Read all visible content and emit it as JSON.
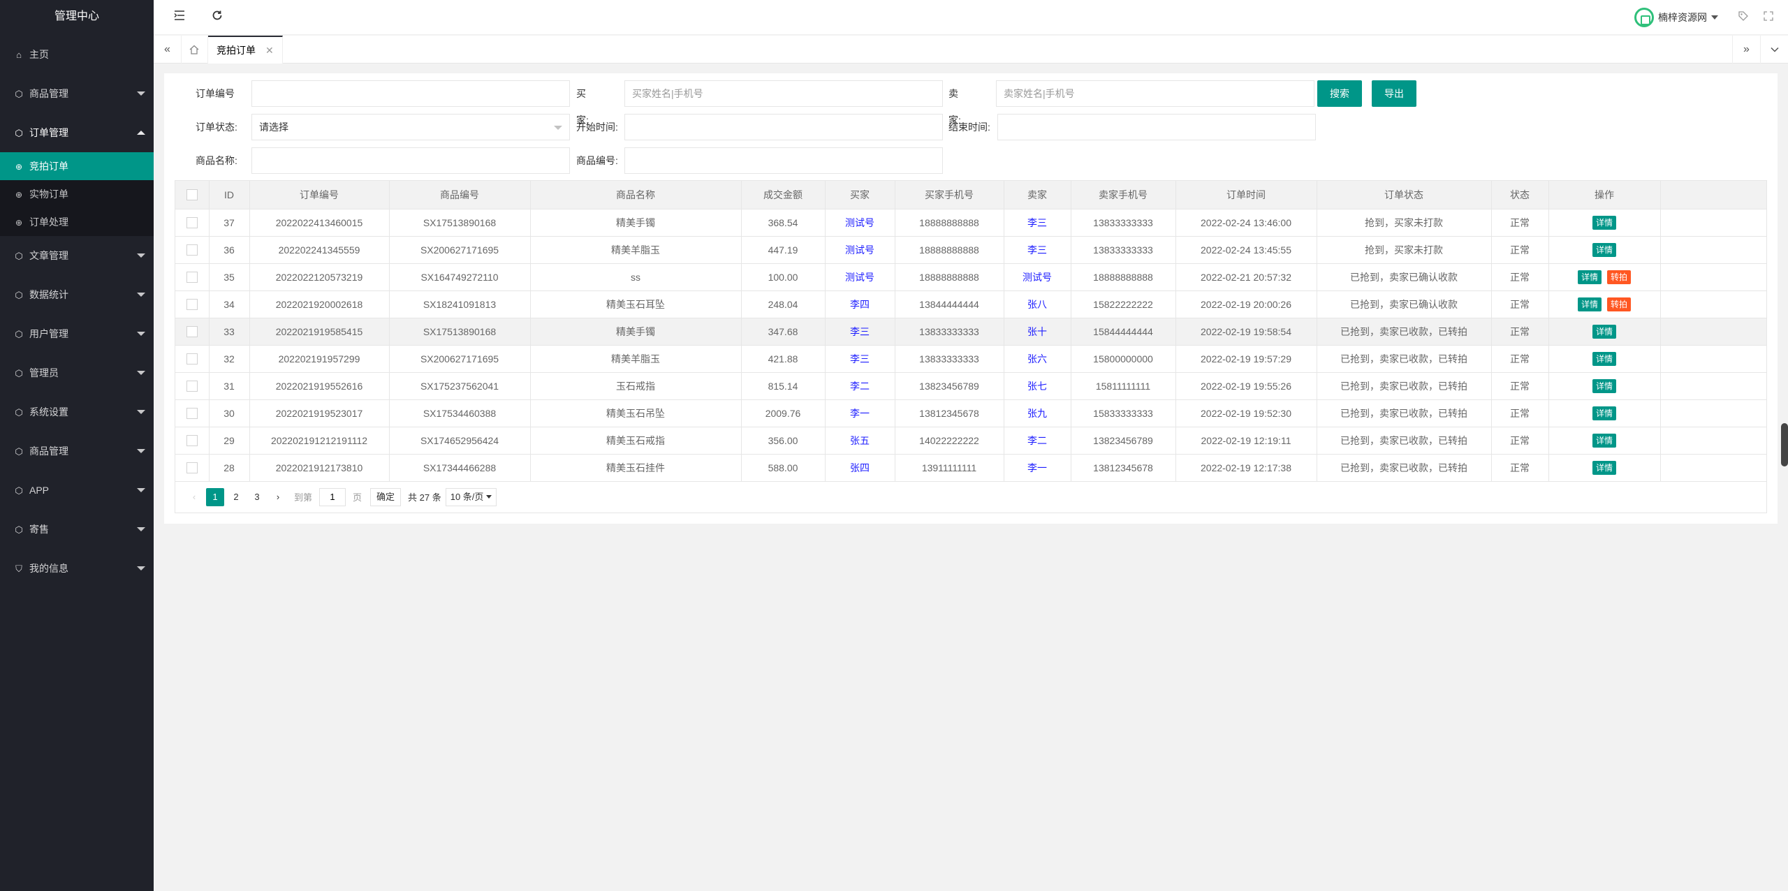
{
  "sidebar": {
    "title": "管理中心",
    "items": [
      {
        "label": "主页",
        "icon": "home-icon"
      },
      {
        "label": "商品管理",
        "icon": "cube-icon"
      },
      {
        "label": "订单管理",
        "icon": "cube-icon",
        "open": true,
        "children": [
          {
            "label": "竞拍订单",
            "active": true
          },
          {
            "label": "实物订单"
          },
          {
            "label": "订单处理"
          }
        ]
      },
      {
        "label": "文章管理",
        "icon": "cube-icon"
      },
      {
        "label": "数据统计",
        "icon": "cube-icon"
      },
      {
        "label": "用户管理",
        "icon": "cube-icon"
      },
      {
        "label": "管理员",
        "icon": "cube-icon"
      },
      {
        "label": "系统设置",
        "icon": "cube-icon"
      },
      {
        "label": "商品管理",
        "icon": "cube-icon"
      },
      {
        "label": "APP",
        "icon": "cube-icon"
      },
      {
        "label": "寄售",
        "icon": "cube-icon"
      },
      {
        "label": "我的信息",
        "icon": "shield-check-icon"
      }
    ]
  },
  "header": {
    "site_name": "楠梓资源网"
  },
  "tabs": {
    "active_label": "竞拍订单"
  },
  "filters": {
    "order_no_label": "订单编号",
    "buyer_label": "买　　家:",
    "buyer_placeholder": "买家姓名|手机号",
    "seller_label": "卖　　家:",
    "seller_placeholder": "卖家姓名|手机号",
    "search_button": "搜索",
    "export_button": "导出",
    "status_label": "订单状态:",
    "status_value": "请选择",
    "start_label": "开始时间:",
    "end_label": "结束时间:",
    "product_name_label": "商品名称:",
    "product_no_label": "商品编号:"
  },
  "table": {
    "headers": [
      "ID",
      "订单编号",
      "商品编号",
      "商品名称",
      "成交金额",
      "买家",
      "买家手机号",
      "卖家",
      "卖家手机号",
      "订单时间",
      "订单状态",
      "状态",
      "操作"
    ],
    "detail_label": "详情",
    "transfer_label": "转拍",
    "rows": [
      {
        "id": "37",
        "order_no": "2022022413460015",
        "product_no": "SX17513890168",
        "product_name": "精美手镯",
        "amount": "368.54",
        "buyer": "测试号",
        "buyer_phone": "18888888888",
        "seller": "李三",
        "seller_phone": "13833333333",
        "time": "2022-02-24 13:46:00",
        "order_status": "抢到，买家未打款",
        "status": "正常",
        "transfer": false
      },
      {
        "id": "36",
        "order_no": "202202241345559",
        "product_no": "SX200627171695",
        "product_name": "精美羊脂玉",
        "amount": "447.19",
        "buyer": "测试号",
        "buyer_phone": "18888888888",
        "seller": "李三",
        "seller_phone": "13833333333",
        "time": "2022-02-24 13:45:55",
        "order_status": "抢到，买家未打款",
        "status": "正常",
        "transfer": false
      },
      {
        "id": "35",
        "order_no": "2022022120573219",
        "product_no": "SX164749272110",
        "product_name": "ss",
        "amount": "100.00",
        "buyer": "测试号",
        "buyer_phone": "18888888888",
        "seller": "测试号",
        "seller_phone": "18888888888",
        "time": "2022-02-21 20:57:32",
        "order_status": "已抢到，卖家已确认收款",
        "status": "正常",
        "transfer": true
      },
      {
        "id": "34",
        "order_no": "2022021920002618",
        "product_no": "SX18241091813",
        "product_name": "精美玉石耳坠",
        "amount": "248.04",
        "buyer": "李四",
        "buyer_phone": "13844444444",
        "seller": "张八",
        "seller_phone": "15822222222",
        "time": "2022-02-19 20:00:26",
        "order_status": "已抢到，卖家已确认收款",
        "status": "正常",
        "transfer": true
      },
      {
        "id": "33",
        "order_no": "2022021919585415",
        "product_no": "SX17513890168",
        "product_name": "精美手镯",
        "amount": "347.68",
        "buyer": "李三",
        "buyer_phone": "13833333333",
        "seller": "张十",
        "seller_phone": "15844444444",
        "time": "2022-02-19 19:58:54",
        "order_status": "已抢到，卖家已收款，已转拍",
        "status": "正常",
        "transfer": false,
        "highlight": true
      },
      {
        "id": "32",
        "order_no": "202202191957299",
        "product_no": "SX200627171695",
        "product_name": "精美羊脂玉",
        "amount": "421.88",
        "buyer": "李三",
        "buyer_phone": "13833333333",
        "seller": "张六",
        "seller_phone": "15800000000",
        "time": "2022-02-19 19:57:29",
        "order_status": "已抢到，卖家已收款，已转拍",
        "status": "正常",
        "transfer": false
      },
      {
        "id": "31",
        "order_no": "2022021919552616",
        "product_no": "SX175237562041",
        "product_name": "玉石戒指",
        "amount": "815.14",
        "buyer": "李二",
        "buyer_phone": "13823456789",
        "seller": "张七",
        "seller_phone": "15811111111",
        "time": "2022-02-19 19:55:26",
        "order_status": "已抢到，卖家已收款，已转拍",
        "status": "正常",
        "transfer": false
      },
      {
        "id": "30",
        "order_no": "2022021919523017",
        "product_no": "SX17534460388",
        "product_name": "精美玉石吊坠",
        "amount": "2009.76",
        "buyer": "李一",
        "buyer_phone": "13812345678",
        "seller": "张九",
        "seller_phone": "15833333333",
        "time": "2022-02-19 19:52:30",
        "order_status": "已抢到，卖家已收款，已转拍",
        "status": "正常",
        "transfer": false
      },
      {
        "id": "29",
        "order_no": "202202191212191112",
        "product_no": "SX174652956424",
        "product_name": "精美玉石戒指",
        "amount": "356.00",
        "buyer": "张五",
        "buyer_phone": "14022222222",
        "seller": "李二",
        "seller_phone": "13823456789",
        "time": "2022-02-19 12:19:11",
        "order_status": "已抢到，卖家已收款，已转拍",
        "status": "正常",
        "transfer": false
      },
      {
        "id": "28",
        "order_no": "2022021912173810",
        "product_no": "SX17344466288",
        "product_name": "精美玉石挂件",
        "amount": "588.00",
        "buyer": "张四",
        "buyer_phone": "13911111111",
        "seller": "李一",
        "seller_phone": "13812345678",
        "time": "2022-02-19 12:17:38",
        "order_status": "已抢到，卖家已收款，已转拍",
        "status": "正常",
        "transfer": false
      }
    ]
  },
  "pagination": {
    "pages": [
      "1",
      "2",
      "3"
    ],
    "current": "1",
    "goto_label": "到第",
    "goto_value": "1",
    "page_unit": "页",
    "confirm": "确定",
    "total": "共 27 条",
    "page_size": "10 条/页"
  },
  "colors": {
    "accent": "#009688",
    "warn": "#ff5722",
    "sidebar_bg": "#20222a",
    "link": "#1e1eff"
  }
}
